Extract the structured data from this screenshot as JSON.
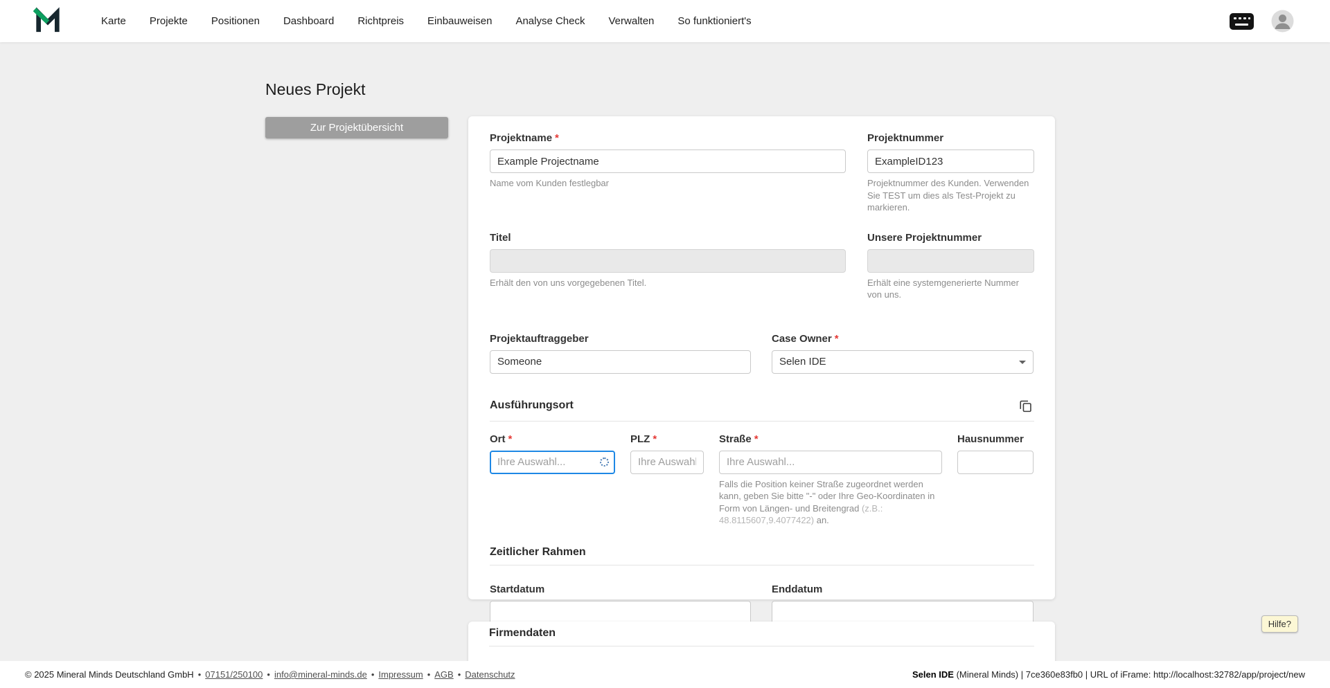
{
  "nav": {
    "items": [
      "Karte",
      "Projekte",
      "Positionen",
      "Dashboard",
      "Richtpreis",
      "Einbauweisen",
      "Analyse Check",
      "Verwalten",
      "So funktioniert's"
    ]
  },
  "page": {
    "title": "Neues Projekt",
    "back_button": "Zur Projektübersicht"
  },
  "ui": {
    "required_marker": "*",
    "bullet": "•"
  },
  "form": {
    "projektname": {
      "label": "Projektname",
      "value": "Example Projectname",
      "helper": "Name vom Kunden festlegbar"
    },
    "projektnummer": {
      "label": "Projektnummer",
      "value": "ExampleID123",
      "helper": "Projektnummer des Kunden. Verwenden Sie TEST um dies als Test-Projekt zu markieren."
    },
    "titel": {
      "label": "Titel",
      "helper": "Erhält den von uns vorgegebenen Titel."
    },
    "unsere_projektnummer": {
      "label": "Unsere Projektnummer",
      "helper": "Erhält eine systemgenerierte Nummer von uns."
    },
    "projektauftraggeber": {
      "label": "Projektauftraggeber",
      "value": "Someone"
    },
    "case_owner": {
      "label": "Case Owner",
      "value": "Selen IDE"
    },
    "sections": {
      "ausfuehrungsort": "Ausführungsort",
      "zeitlicher_rahmen": "Zeitlicher Rahmen",
      "firmendaten": "Firmendaten"
    },
    "ort": {
      "label": "Ort",
      "placeholder": "Ihre Auswahl..."
    },
    "plz": {
      "label": "PLZ",
      "placeholder": "Ihre Auswahl."
    },
    "strasse": {
      "label": "Straße",
      "placeholder": "Ihre Auswahl...",
      "helper_1": "Falls die Position keiner Straße zugeordnet werden kann, geben Sie bitte \"-\" oder Ihre Geo-Koordinaten in Form von Längen- und Breitengrad ",
      "helper_2": "(z.B.: 48.8115607,9.4077422)",
      "helper_3": " an."
    },
    "hausnummer": {
      "label": "Hausnummer"
    },
    "startdatum": {
      "label": "Startdatum"
    },
    "enddatum": {
      "label": "Enddatum"
    }
  },
  "help": {
    "label": "Hilfe?"
  },
  "footer": {
    "copyright": "© 2025 Mineral Minds Deutschland GmbH",
    "links": [
      "07151/250100",
      "info@mineral-minds.de",
      "Impressum",
      "AGB",
      "Datenschutz"
    ],
    "session_user": "Selen IDE",
    "session_info": " (Mineral Minds) | 7ce360e83fb0 | URL of iFrame: http://localhost:32782/app/project/new"
  }
}
